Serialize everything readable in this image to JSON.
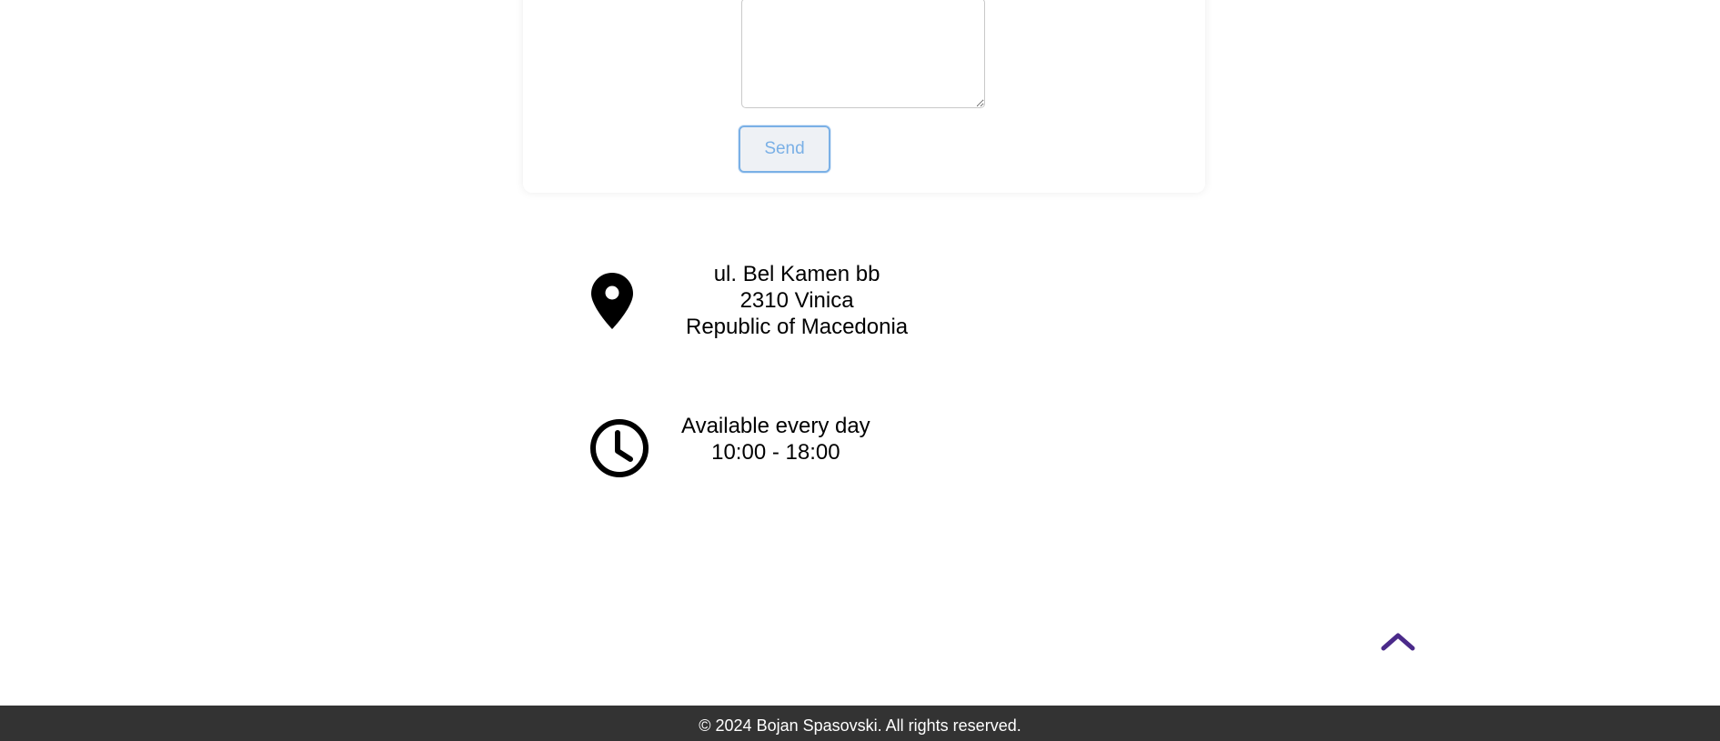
{
  "contact_form": {
    "message_value": "",
    "send_label": "Send"
  },
  "address": {
    "icon": "map-pin-icon",
    "line1": "ul. Bel Kamen bb",
    "line2": "2310 Vinica",
    "line3": "Republic of Macedonia"
  },
  "hours": {
    "icon": "clock-icon",
    "line1": "Available every day",
    "line2": "10:00 - 18:00"
  },
  "scroll_top": {
    "icon": "chevron-up-icon",
    "color": "#4b2a8a"
  },
  "footer": {
    "text": "© 2024 Bojan Spasovski. All rights reserved.",
    "background": "#333333"
  }
}
